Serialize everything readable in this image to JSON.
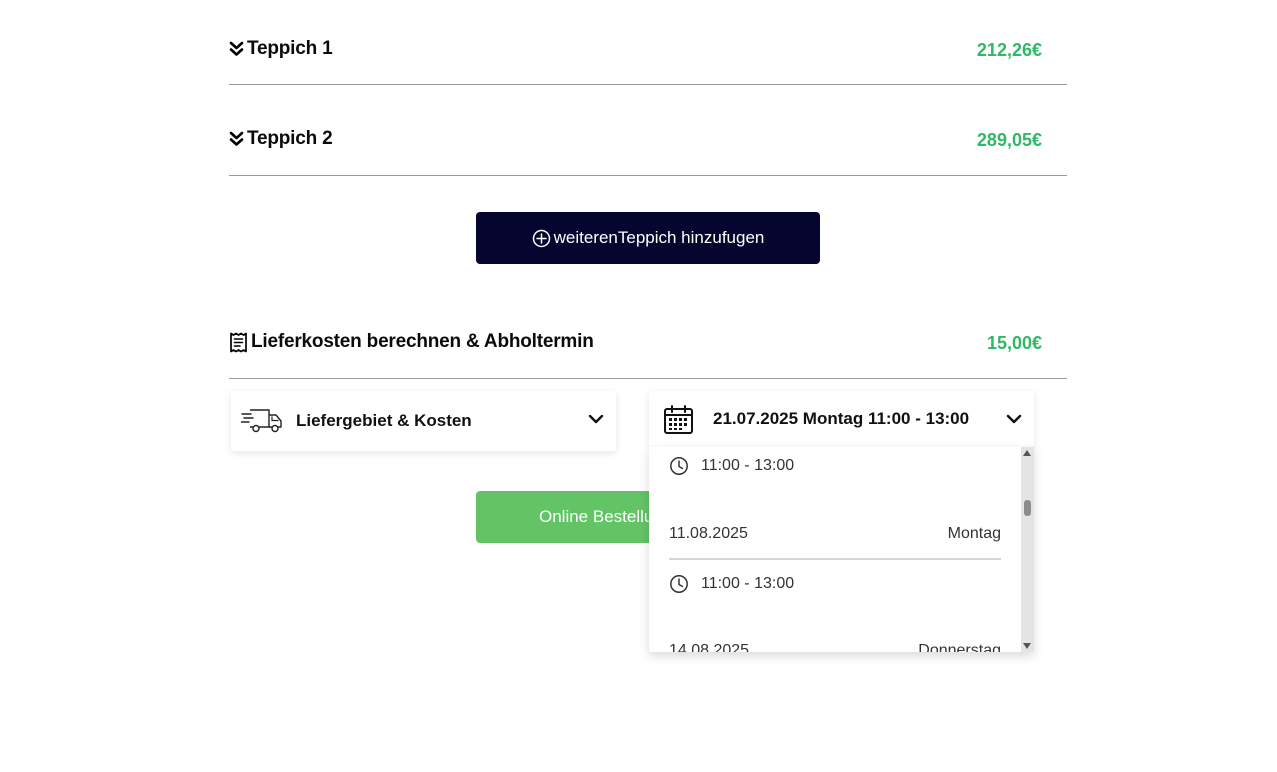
{
  "items": [
    {
      "title": "Teppich 1",
      "price": "212,26€",
      "icon": "chevrons-down-icon"
    },
    {
      "title": "Teppich 2",
      "price": "289,05€",
      "icon": "chevrons-down-icon"
    }
  ],
  "add_button": {
    "label": "weiterenTeppich hinzufugen",
    "icon": "plus-circle-icon"
  },
  "delivery": {
    "title": "Lieferkosten berechnen & Abholtermin",
    "price": "15,00€",
    "icon": "receipt-icon",
    "area_select": {
      "label": "Liefergebiet & Kosten",
      "icon": "truck-icon"
    },
    "date_select": {
      "label": "21.07.2025 Montag 11:00 - 13:00",
      "icon": "calendar-icon"
    }
  },
  "dropdown": {
    "entries": [
      {
        "time": "11:00 - 13:00"
      },
      {
        "date": "11.08.2025",
        "weekday": "Montag",
        "time": "11:00 - 13:00"
      },
      {
        "date": "14.08.2025",
        "weekday": "Donnerstag"
      }
    ]
  },
  "order_button": {
    "label": "Online Bestellu"
  },
  "colors": {
    "price_green": "#2fb865",
    "primary_navy": "#05052f",
    "order_green": "#63c466"
  }
}
